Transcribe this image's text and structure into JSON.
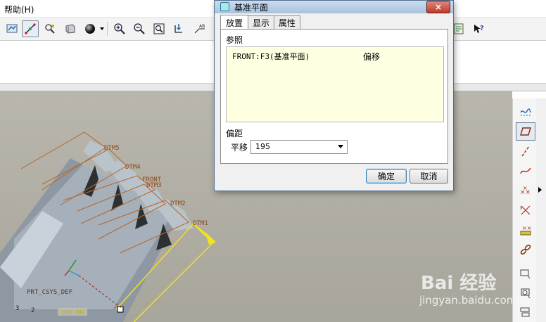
{
  "menubar": {
    "help_label": "帮助(H)"
  },
  "toolbar": {
    "icons": [
      "repaint-icon",
      "spin-center-icon",
      "orient-icon",
      "saved-views-icon",
      "shading-icon",
      "zoom-in-icon",
      "zoom-out-icon",
      "refit-icon",
      "reorient-icon",
      "datum-display-icon",
      "model-tree-icon",
      "whats-this-icon"
    ]
  },
  "viewport": {
    "datums": [
      "DTM5",
      "DTM4",
      "FRONT",
      "DTM3",
      "DTM2",
      "DTM1"
    ],
    "csys_label": "PRT_CSYS_DEF",
    "dimension_value": "180.00",
    "small_labels": [
      "3",
      "2"
    ]
  },
  "watermark": {
    "brand": "Bai 经验",
    "url": "jingyan.baidu.com"
  },
  "dialog": {
    "title": "基准平面",
    "close_label": "×",
    "tabs": [
      "放置",
      "显示",
      "属性"
    ],
    "references_label": "参照",
    "reference": {
      "name": "FRONT:F3(基准平面)",
      "type": "偏移"
    },
    "offset_label": "偏距",
    "translate_label": "平移",
    "translate_value": "195",
    "ok_label": "确定",
    "cancel_label": "取消"
  }
}
